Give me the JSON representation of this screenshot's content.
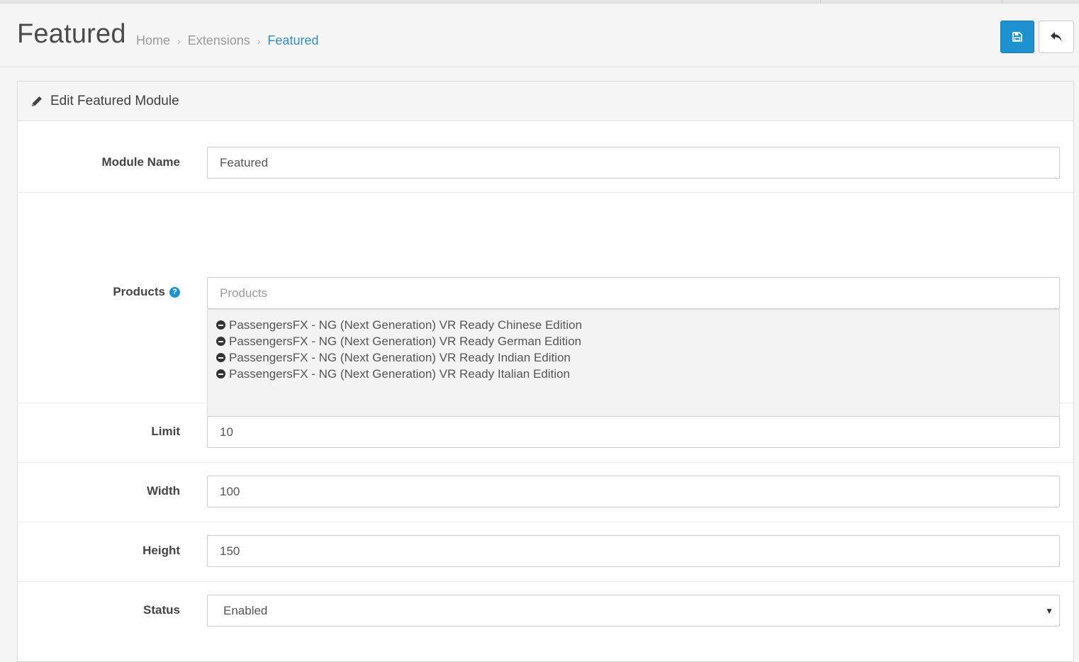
{
  "header": {
    "title": "Featured",
    "breadcrumb": [
      "Home",
      "Extensions",
      "Featured"
    ]
  },
  "toolbar": {
    "save_icon": "floppy-disk-icon",
    "back_icon": "reply-arrow-icon",
    "save_color": "#1e91cf"
  },
  "panel": {
    "heading_icon": "pencil-icon",
    "title": "Edit Featured Module"
  },
  "form": {
    "module_name": {
      "label": "Module Name",
      "value": "Featured"
    },
    "products": {
      "label": "Products",
      "placeholder": "Products",
      "help_icon": "question-circle-icon",
      "items": [
        "PassengersFX - NG (Next Generation) VR Ready Chinese Edition",
        "PassengersFX - NG (Next Generation) VR Ready German Edition",
        "PassengersFX - NG (Next Generation) VR Ready Indian Edition",
        "PassengersFX - NG (Next Generation) VR Ready Italian Edition"
      ]
    },
    "limit": {
      "label": "Limit",
      "value": "10"
    },
    "width": {
      "label": "Width",
      "value": "100"
    },
    "height": {
      "label": "Height",
      "value": "150"
    },
    "status": {
      "label": "Status",
      "value": "Enabled"
    }
  }
}
